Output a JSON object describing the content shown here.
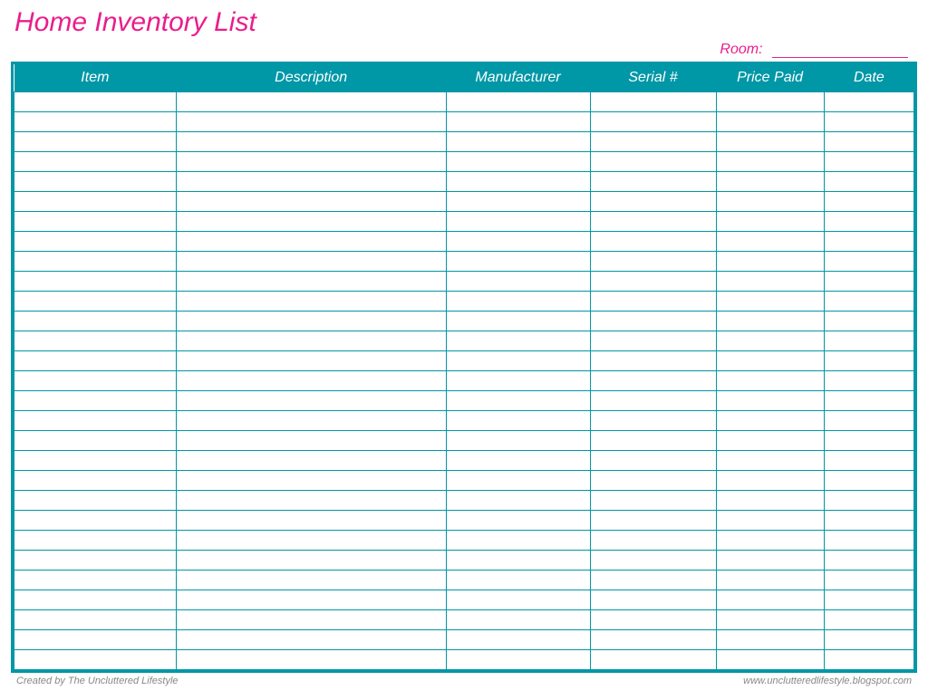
{
  "title": "Home Inventory List",
  "room_label": "Room:",
  "columns": [
    {
      "key": "item",
      "label": "Item",
      "class": "col-item"
    },
    {
      "key": "description",
      "label": "Description",
      "class": "col-desc"
    },
    {
      "key": "manufacturer",
      "label": "Manufacturer",
      "class": "col-mfr"
    },
    {
      "key": "serial",
      "label": "Serial #",
      "class": "col-ser"
    },
    {
      "key": "price_paid",
      "label": "Price Paid",
      "class": "col-price"
    },
    {
      "key": "date",
      "label": "Date",
      "class": "col-date"
    }
  ],
  "row_count": 29,
  "footer": {
    "created_by": "Created by The Uncluttered Lifestyle",
    "url": "www.unclutteredlifestyle.blogspot.com"
  },
  "colors": {
    "accent_pink": "#e91e8c",
    "accent_teal": "#0097a7"
  }
}
